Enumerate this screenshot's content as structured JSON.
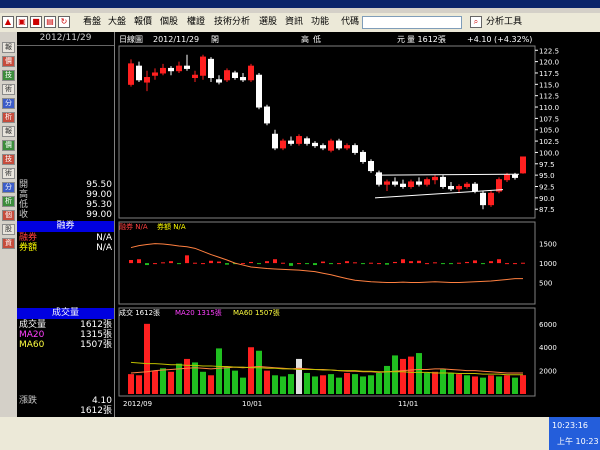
{
  "toolbar": {
    "items": [
      "看盤",
      "大盤",
      "報價",
      "個股",
      "權證",
      "技術分析",
      "選股",
      "資訊",
      "功能",
      "代碼",
      "分析工具"
    ]
  },
  "left_tabs": [
    "報",
    "價",
    "技",
    "術",
    "分",
    "析",
    "報",
    "價",
    "技",
    "術",
    "分",
    "析",
    "個",
    "股",
    "資"
  ],
  "info": {
    "date": "2012/11/29",
    "quote_rows": [
      {
        "label": "開",
        "value": "95.50"
      },
      {
        "label": "高",
        "value": "99.00"
      },
      {
        "label": "低",
        "value": "95.30"
      },
      {
        "label": "收",
        "value": "99.00"
      }
    ],
    "margin_title": "融券",
    "margin_rows": [
      {
        "label": "融券",
        "value": "N/A"
      },
      {
        "label": "券額",
        "value": "N/A"
      }
    ],
    "volume_title": "成交量",
    "volume_rows": [
      {
        "label": "成交量",
        "value": "1612張"
      },
      {
        "label": "MA20",
        "value": "1315張"
      },
      {
        "label": "MA60",
        "value": "1507張"
      }
    ],
    "bottom_rows": [
      {
        "label": "漲跌",
        "value": "4.10"
      },
      {
        "label": "",
        "value": "1612張"
      }
    ]
  },
  "chart_header": {
    "prefix": "日線圖",
    "date": "2012/11/29",
    "label_open": "開",
    "label_high": "高",
    "label_low": "低",
    "label_close": "元",
    "volume": "量 1612張",
    "change": "+4.10 (+4.32%)"
  },
  "margin_legend": {
    "a": "融券 N/A",
    "b": "券額 N/A"
  },
  "volume_legend": {
    "a": "成交 1612張",
    "b": "MA20 1315張",
    "c": "MA60 1507張"
  },
  "x_labels": [
    "2012/09",
    "10/01",
    "11/01"
  ],
  "tray": {
    "time1": "10:23:16",
    "time2": "上午 10:23"
  },
  "colors": {
    "up": "#ff2020",
    "down": "#20c020",
    "ma": "#ff8040",
    "ma2": "#c0c000"
  },
  "chart_data": [
    {
      "type": "candlestick",
      "y_ticks": [
        122.5,
        120.0,
        117.5,
        115.0,
        112.5,
        110.0,
        107.5,
        105.0,
        102.5,
        100.0,
        97.5,
        95.0,
        92.5,
        90.0,
        87.5
      ],
      "ylim": [
        86,
        123
      ],
      "candles": [
        {
          "o": 115.0,
          "h": 120.5,
          "l": 114.5,
          "c": 119.5
        },
        {
          "o": 119.0,
          "h": 120.0,
          "l": 115.5,
          "c": 116.0
        },
        {
          "o": 115.5,
          "h": 118.0,
          "l": 113.5,
          "c": 116.5
        },
        {
          "o": 117.0,
          "h": 118.5,
          "l": 116.0,
          "c": 117.5
        },
        {
          "o": 117.5,
          "h": 119.5,
          "l": 117.0,
          "c": 118.5
        },
        {
          "o": 118.5,
          "h": 119.0,
          "l": 117.0,
          "c": 118.0
        },
        {
          "o": 118.0,
          "h": 120.0,
          "l": 117.5,
          "c": 119.0
        },
        {
          "o": 119.0,
          "h": 121.5,
          "l": 118.0,
          "c": 118.5
        },
        {
          "o": 116.5,
          "h": 118.0,
          "l": 115.5,
          "c": 117.0
        },
        {
          "o": 117.0,
          "h": 121.5,
          "l": 116.0,
          "c": 121.0
        },
        {
          "o": 120.5,
          "h": 121.0,
          "l": 115.5,
          "c": 116.5
        },
        {
          "o": 116.0,
          "h": 117.0,
          "l": 115.0,
          "c": 115.5
        },
        {
          "o": 116.0,
          "h": 118.5,
          "l": 115.5,
          "c": 118.0
        },
        {
          "o": 117.5,
          "h": 118.0,
          "l": 116.0,
          "c": 116.5
        },
        {
          "o": 116.5,
          "h": 117.5,
          "l": 115.5,
          "c": 116.0
        },
        {
          "o": 116.0,
          "h": 119.5,
          "l": 115.5,
          "c": 119.0
        },
        {
          "o": 117.0,
          "h": 117.5,
          "l": 109.5,
          "c": 110.0
        },
        {
          "o": 110.0,
          "h": 110.5,
          "l": 106.0,
          "c": 106.5
        },
        {
          "o": 104.0,
          "h": 105.0,
          "l": 100.5,
          "c": 101.0
        },
        {
          "o": 101.0,
          "h": 103.0,
          "l": 100.5,
          "c": 102.5
        },
        {
          "o": 102.5,
          "h": 103.5,
          "l": 101.5,
          "c": 102.0
        },
        {
          "o": 102.0,
          "h": 104.0,
          "l": 101.5,
          "c": 103.5
        },
        {
          "o": 103.0,
          "h": 103.5,
          "l": 101.5,
          "c": 102.0
        },
        {
          "o": 102.0,
          "h": 102.5,
          "l": 101.0,
          "c": 101.5
        },
        {
          "o": 101.5,
          "h": 102.0,
          "l": 100.5,
          "c": 101.0
        },
        {
          "o": 100.5,
          "h": 103.0,
          "l": 100.0,
          "c": 102.5
        },
        {
          "o": 102.5,
          "h": 103.0,
          "l": 100.5,
          "c": 101.0
        },
        {
          "o": 101.0,
          "h": 102.0,
          "l": 100.5,
          "c": 101.5
        },
        {
          "o": 101.5,
          "h": 102.0,
          "l": 99.5,
          "c": 100.0
        },
        {
          "o": 100.0,
          "h": 100.5,
          "l": 97.5,
          "c": 98.0
        },
        {
          "o": 98.0,
          "h": 98.5,
          "l": 95.5,
          "c": 96.0
        },
        {
          "o": 95.5,
          "h": 96.0,
          "l": 92.5,
          "c": 93.0
        },
        {
          "o": 93.0,
          "h": 94.0,
          "l": 91.5,
          "c": 93.5
        },
        {
          "o": 93.5,
          "h": 94.5,
          "l": 92.5,
          "c": 93.0
        },
        {
          "o": 93.0,
          "h": 94.0,
          "l": 92.0,
          "c": 92.5
        },
        {
          "o": 92.5,
          "h": 94.0,
          "l": 92.0,
          "c": 93.5
        },
        {
          "o": 93.5,
          "h": 94.5,
          "l": 92.5,
          "c": 93.0
        },
        {
          "o": 93.0,
          "h": 94.5,
          "l": 92.5,
          "c": 94.0
        },
        {
          "o": 94.0,
          "h": 95.0,
          "l": 93.0,
          "c": 94.5
        },
        {
          "o": 94.5,
          "h": 95.0,
          "l": 92.0,
          "c": 92.5
        },
        {
          "o": 92.5,
          "h": 93.5,
          "l": 91.5,
          "c": 92.0
        },
        {
          "o": 92.0,
          "h": 93.0,
          "l": 91.0,
          "c": 92.5
        },
        {
          "o": 92.5,
          "h": 93.5,
          "l": 92.0,
          "c": 93.0
        },
        {
          "o": 93.0,
          "h": 93.5,
          "l": 91.0,
          "c": 91.5
        },
        {
          "o": 91.0,
          "h": 91.5,
          "l": 87.5,
          "c": 88.5
        },
        {
          "o": 88.5,
          "h": 91.5,
          "l": 88.0,
          "c": 91.0
        },
        {
          "o": 91.5,
          "h": 94.5,
          "l": 91.0,
          "c": 94.0
        },
        {
          "o": 94.0,
          "h": 95.5,
          "l": 93.5,
          "c": 95.0
        },
        {
          "o": 95.0,
          "h": 95.5,
          "l": 94.0,
          "c": 94.5
        },
        {
          "o": 95.5,
          "h": 99.0,
          "l": 95.3,
          "c": 99.0
        }
      ]
    },
    {
      "type": "bar",
      "y_ticks": [
        1500,
        1000,
        500
      ],
      "ylim": [
        0,
        1800
      ],
      "baseline": 1000,
      "values": [
        1080,
        1100,
        950,
        1000,
        1020,
        1050,
        990,
        1200,
        1010,
        1000,
        1060,
        1040,
        960,
        980,
        1000,
        1030,
        990,
        1050,
        1100,
        1010,
        930,
        1000,
        990,
        950,
        1040,
        980,
        1000,
        1050,
        1020,
        990,
        1010,
        1000,
        960,
        1030,
        1100,
        1050,
        1060,
        1000,
        1020,
        980,
        990,
        1010,
        1030,
        1070,
        990,
        1050,
        1100,
        1000,
        1000,
        1010
      ],
      "line": [
        1400,
        1450,
        1480,
        1500,
        1490,
        1470,
        1440,
        1420,
        1380,
        1300,
        1220,
        1150,
        1080,
        1000,
        950,
        900,
        880,
        860,
        850,
        840,
        830,
        820,
        800,
        780,
        740,
        700,
        650,
        600,
        560,
        540,
        520,
        510,
        500,
        500,
        510,
        500,
        500,
        510,
        520,
        510,
        500,
        500,
        510,
        520,
        530,
        540,
        560,
        580,
        600,
        600
      ]
    },
    {
      "type": "bar",
      "y_ticks": [
        6000,
        4000,
        2000
      ],
      "ylim": [
        0,
        6500
      ],
      "values": [
        1700,
        1600,
        6000,
        2000,
        2200,
        1900,
        2600,
        3000,
        2700,
        1900,
        1600,
        3900,
        2300,
        2000,
        1400,
        4000,
        3700,
        2000,
        1600,
        1500,
        1700,
        3000,
        1800,
        1500,
        1600,
        1700,
        1400,
        1800,
        1700,
        1500,
        1600,
        1800,
        2400,
        3300,
        3000,
        3200,
        3500,
        1800,
        1900,
        2100,
        1800,
        1700,
        1600,
        1500,
        1400,
        1600,
        1500,
        1600,
        1400,
        1612
      ],
      "colors": [
        "up",
        "up",
        "up",
        "up",
        "down",
        "up",
        "down",
        "up",
        "down",
        "down",
        "up",
        "down",
        "down",
        "down",
        "down",
        "up",
        "down",
        "up",
        "down",
        "down",
        "down",
        "white",
        "down",
        "down",
        "up",
        "down",
        "down",
        "up",
        "down",
        "down",
        "down",
        "down",
        "down",
        "down",
        "up",
        "up",
        "down",
        "down",
        "up",
        "down",
        "down",
        "up",
        "down",
        "up",
        "down",
        "up",
        "down",
        "up",
        "down",
        "up"
      ],
      "ma20": [
        1800,
        1850,
        1900,
        2000,
        2050,
        2100,
        2150,
        2200,
        2250,
        2200,
        2150,
        2200,
        2250,
        2300,
        2250,
        2300,
        2350,
        2300,
        2250,
        2200,
        2150,
        2200,
        2150,
        2100,
        2100,
        2050,
        2000,
        1950,
        1950,
        1900,
        1900,
        1850,
        1900,
        1950,
        2000,
        2050,
        2100,
        2100,
        2150,
        2150,
        2100,
        2050,
        2000,
        2000,
        1950,
        1900,
        1850,
        1800,
        1800,
        1800
      ],
      "ma60": [
        2700,
        2650,
        2600,
        2600,
        2550,
        2500,
        2500,
        2450,
        2450,
        2400,
        2400,
        2350,
        2350,
        2300,
        2300,
        2250,
        2250,
        2200,
        2200,
        2150,
        2150,
        2100,
        2100,
        2100,
        2050,
        2050,
        2000,
        2000,
        2000,
        1950,
        1950,
        1900,
        1900,
        1900,
        1900,
        1850,
        1850,
        1850,
        1800,
        1800,
        1800,
        1750,
        1750,
        1750,
        1700,
        1700,
        1700,
        1650,
        1650,
        1650
      ]
    }
  ]
}
